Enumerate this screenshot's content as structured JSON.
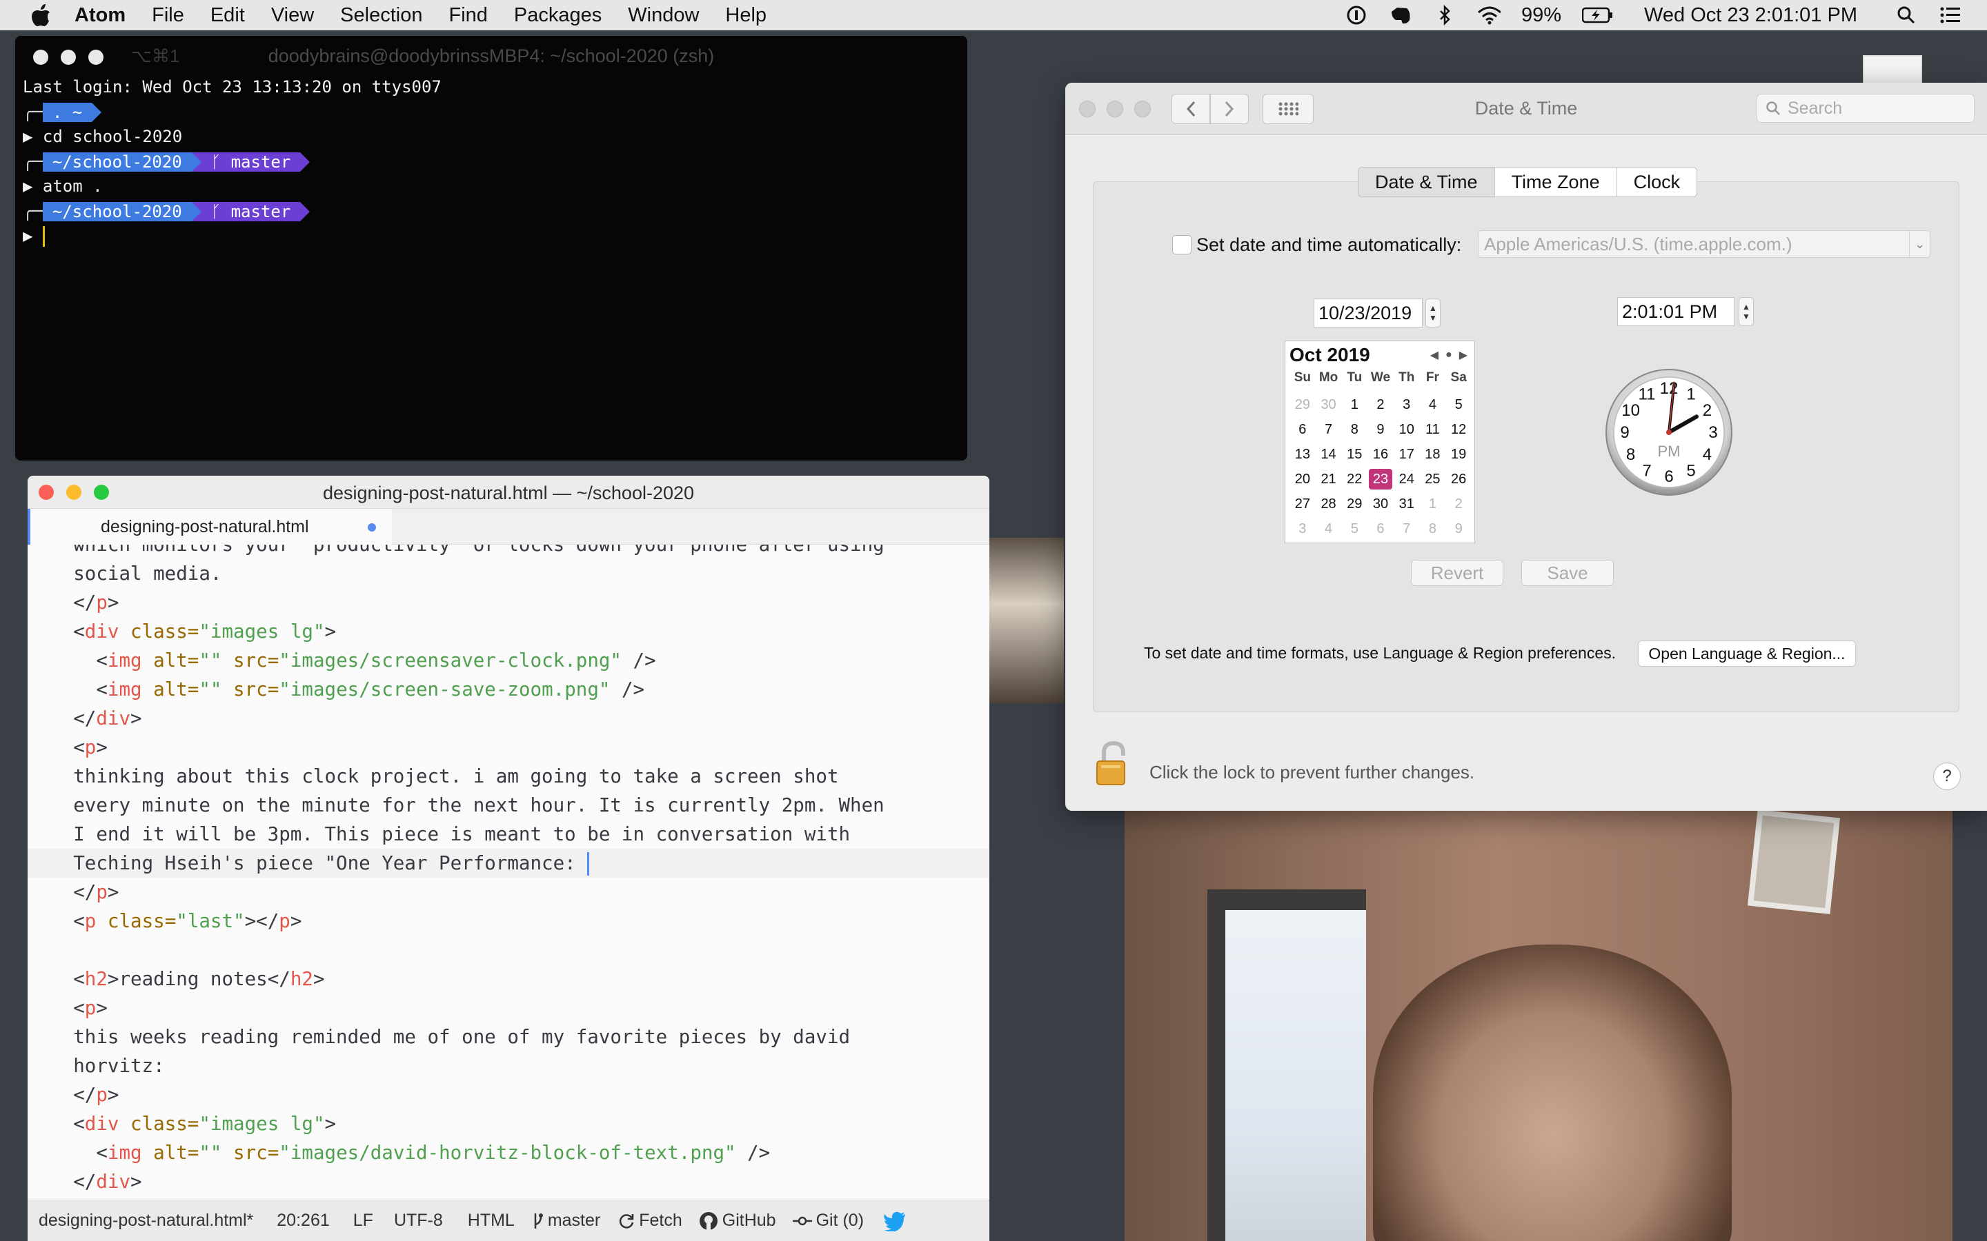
{
  "menubar": {
    "app_name": "Atom",
    "items": [
      "File",
      "Edit",
      "View",
      "Selection",
      "Find",
      "Packages",
      "Window",
      "Help"
    ],
    "battery": "99%",
    "datetime": "Wed Oct 23  2:01:01 PM"
  },
  "terminal": {
    "shortcut": "⌥⌘1",
    "title": "doodybrains@doodybrinssMBP4: ~/school-2020 (zsh)",
    "last_login": "Last login: Wed Oct 23 13:13:20 on ttys007",
    "home_segment": ". ~",
    "prompt_char": "▶",
    "cmd1": "cd school-2020",
    "path_segment": "~/school-2020",
    "git_segment": "ᚴ master",
    "cmd2": "atom ."
  },
  "atom": {
    "window_title": "designing-post-natural.html — ~/school-2020",
    "tab_label": "designing-post-natural.html",
    "status": {
      "file": "designing-post-natural.html*",
      "cursor": "20:261",
      "line_ending": "LF",
      "encoding": "UTF-8",
      "grammar": "HTML",
      "branch": "master",
      "fetch": "Fetch",
      "github": "GitHub",
      "git": "Git (0)"
    }
  },
  "code": {
    "l0": "    which monitors your \"productivity\" or locks down your phone after using",
    "l1": "    social media.",
    "l4a": "      <img alt=\"\" src=\"images/screensaver-clock.png\" />",
    "l6_text1": "    thinking about this clock project. i am going to take a screen shot",
    "l6_text2": "    every minute on the minute for the next hour. It is currently 2pm. When",
    "l6_text3": "    I end it will be 3pm. This piece is meant to be in conversation with",
    "l6_text4": "    Teching Hseih's piece \"One Year Performance: ",
    "reading_intro1": "    this weeks reading reminded me of one of my favorite pieces by david",
    "reading_intro2": "    horvitz:",
    "tok": {
      "lt": "<",
      "gt": ">",
      "ltslash": "</",
      "close_void": " />",
      "p": "p",
      "div": "div",
      "img": "img",
      "h2": "h2",
      "class_attr": " class=",
      "alt_attr": " alt=",
      "src_attr": " src=",
      "images_lg": "\"images lg\"",
      "last": "\"last\"",
      "empty": "\"\"",
      "src1": "\"images/screensaver-clock.png\"",
      "src2": "\"images/screen-save-zoom.png\"",
      "src3": "\"images/david-horvitz-block-of-text.png\"",
      "reading_notes": "reading notes"
    }
  },
  "prefs": {
    "title": "Date & Time",
    "search_placeholder": "Search",
    "tabs": [
      "Date & Time",
      "Time Zone",
      "Clock"
    ],
    "auto_label": "Set date and time automatically:",
    "time_server": "Apple Americas/U.S. (time.apple.com.)",
    "date_value": "10/23/2019",
    "time_value": "2:01:01 PM",
    "calendar": {
      "month": "Oct 2019",
      "dows": [
        "Su",
        "Mo",
        "Tu",
        "We",
        "Th",
        "Fr",
        "Sa"
      ],
      "days": [
        [
          "29",
          "30",
          "1",
          "2",
          "3",
          "4",
          "5"
        ],
        [
          "6",
          "7",
          "8",
          "9",
          "10",
          "11",
          "12"
        ],
        [
          "13",
          "14",
          "15",
          "16",
          "17",
          "18",
          "19"
        ],
        [
          "20",
          "21",
          "22",
          "23",
          "24",
          "25",
          "26"
        ],
        [
          "27",
          "28",
          "29",
          "30",
          "31",
          "1",
          "2"
        ],
        [
          "3",
          "4",
          "5",
          "6",
          "7",
          "8",
          "9"
        ]
      ],
      "selected": "23"
    },
    "clock": {
      "numbers": [
        "12",
        "1",
        "2",
        "3",
        "4",
        "5",
        "6",
        "7",
        "8",
        "9",
        "10",
        "11"
      ],
      "ampm": "PM",
      "hours": 2,
      "minutes": 1,
      "seconds": 1
    },
    "revert": "Revert",
    "save": "Save",
    "formats_text": "To set date and time formats, use Language & Region preferences.",
    "open_lang": "Open Language & Region...",
    "lock_text": "Click the lock to prevent further changes.",
    "help": "?"
  }
}
